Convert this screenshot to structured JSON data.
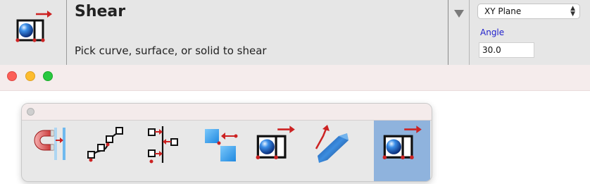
{
  "command": {
    "title": "Shear",
    "prompt": "Pick curve, surface, or solid to shear",
    "icon": "shear-icon"
  },
  "options": {
    "plane_select": {
      "value": "XY Plane"
    },
    "angle": {
      "label": "Angle",
      "value": "30.0"
    }
  },
  "window": {
    "controls": [
      "close",
      "minimize",
      "zoom"
    ]
  },
  "palette": {
    "tools": [
      {
        "name": "snap-magnet-icon",
        "active": false
      },
      {
        "name": "control-points-curve-icon",
        "active": false
      },
      {
        "name": "align-points-icon",
        "active": false
      },
      {
        "name": "move-squares-icon",
        "active": false
      },
      {
        "name": "shear-sphere-icon",
        "active": false
      },
      {
        "name": "twist-bend-icon",
        "active": false
      },
      {
        "name": "shear-icon",
        "active": true
      }
    ]
  },
  "colors": {
    "accent_red": "#cc2222",
    "active_tool": "#8fb3dd",
    "angle_label": "#2222cc"
  }
}
